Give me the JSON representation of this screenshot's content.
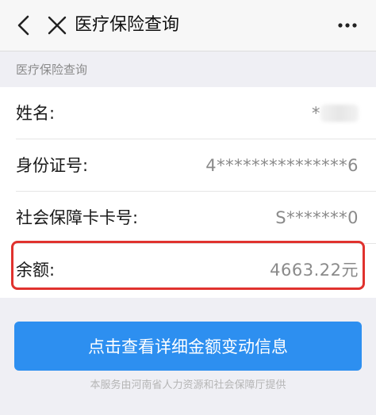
{
  "nav": {
    "title": "医疗保险查询",
    "back_icon": "chevron-left-icon",
    "close_icon": "close-icon",
    "more_icon": "more-icon"
  },
  "section": {
    "header": "医疗保险查询"
  },
  "rows": [
    {
      "label": "姓名:",
      "value": "*"
    },
    {
      "label": "身份证号:",
      "value": "4***************6"
    },
    {
      "label": "社会保障卡卡号:",
      "value": "S*******0"
    },
    {
      "label": "余额:",
      "value": "4663.22元"
    }
  ],
  "action_button": {
    "label": "点击查看详细金额变动信息"
  },
  "footer": {
    "text": "本服务由河南省人力资源和社会保障厅提供"
  },
  "colors": {
    "accent": "#2d8ff0",
    "highlight": "#e0322e"
  }
}
